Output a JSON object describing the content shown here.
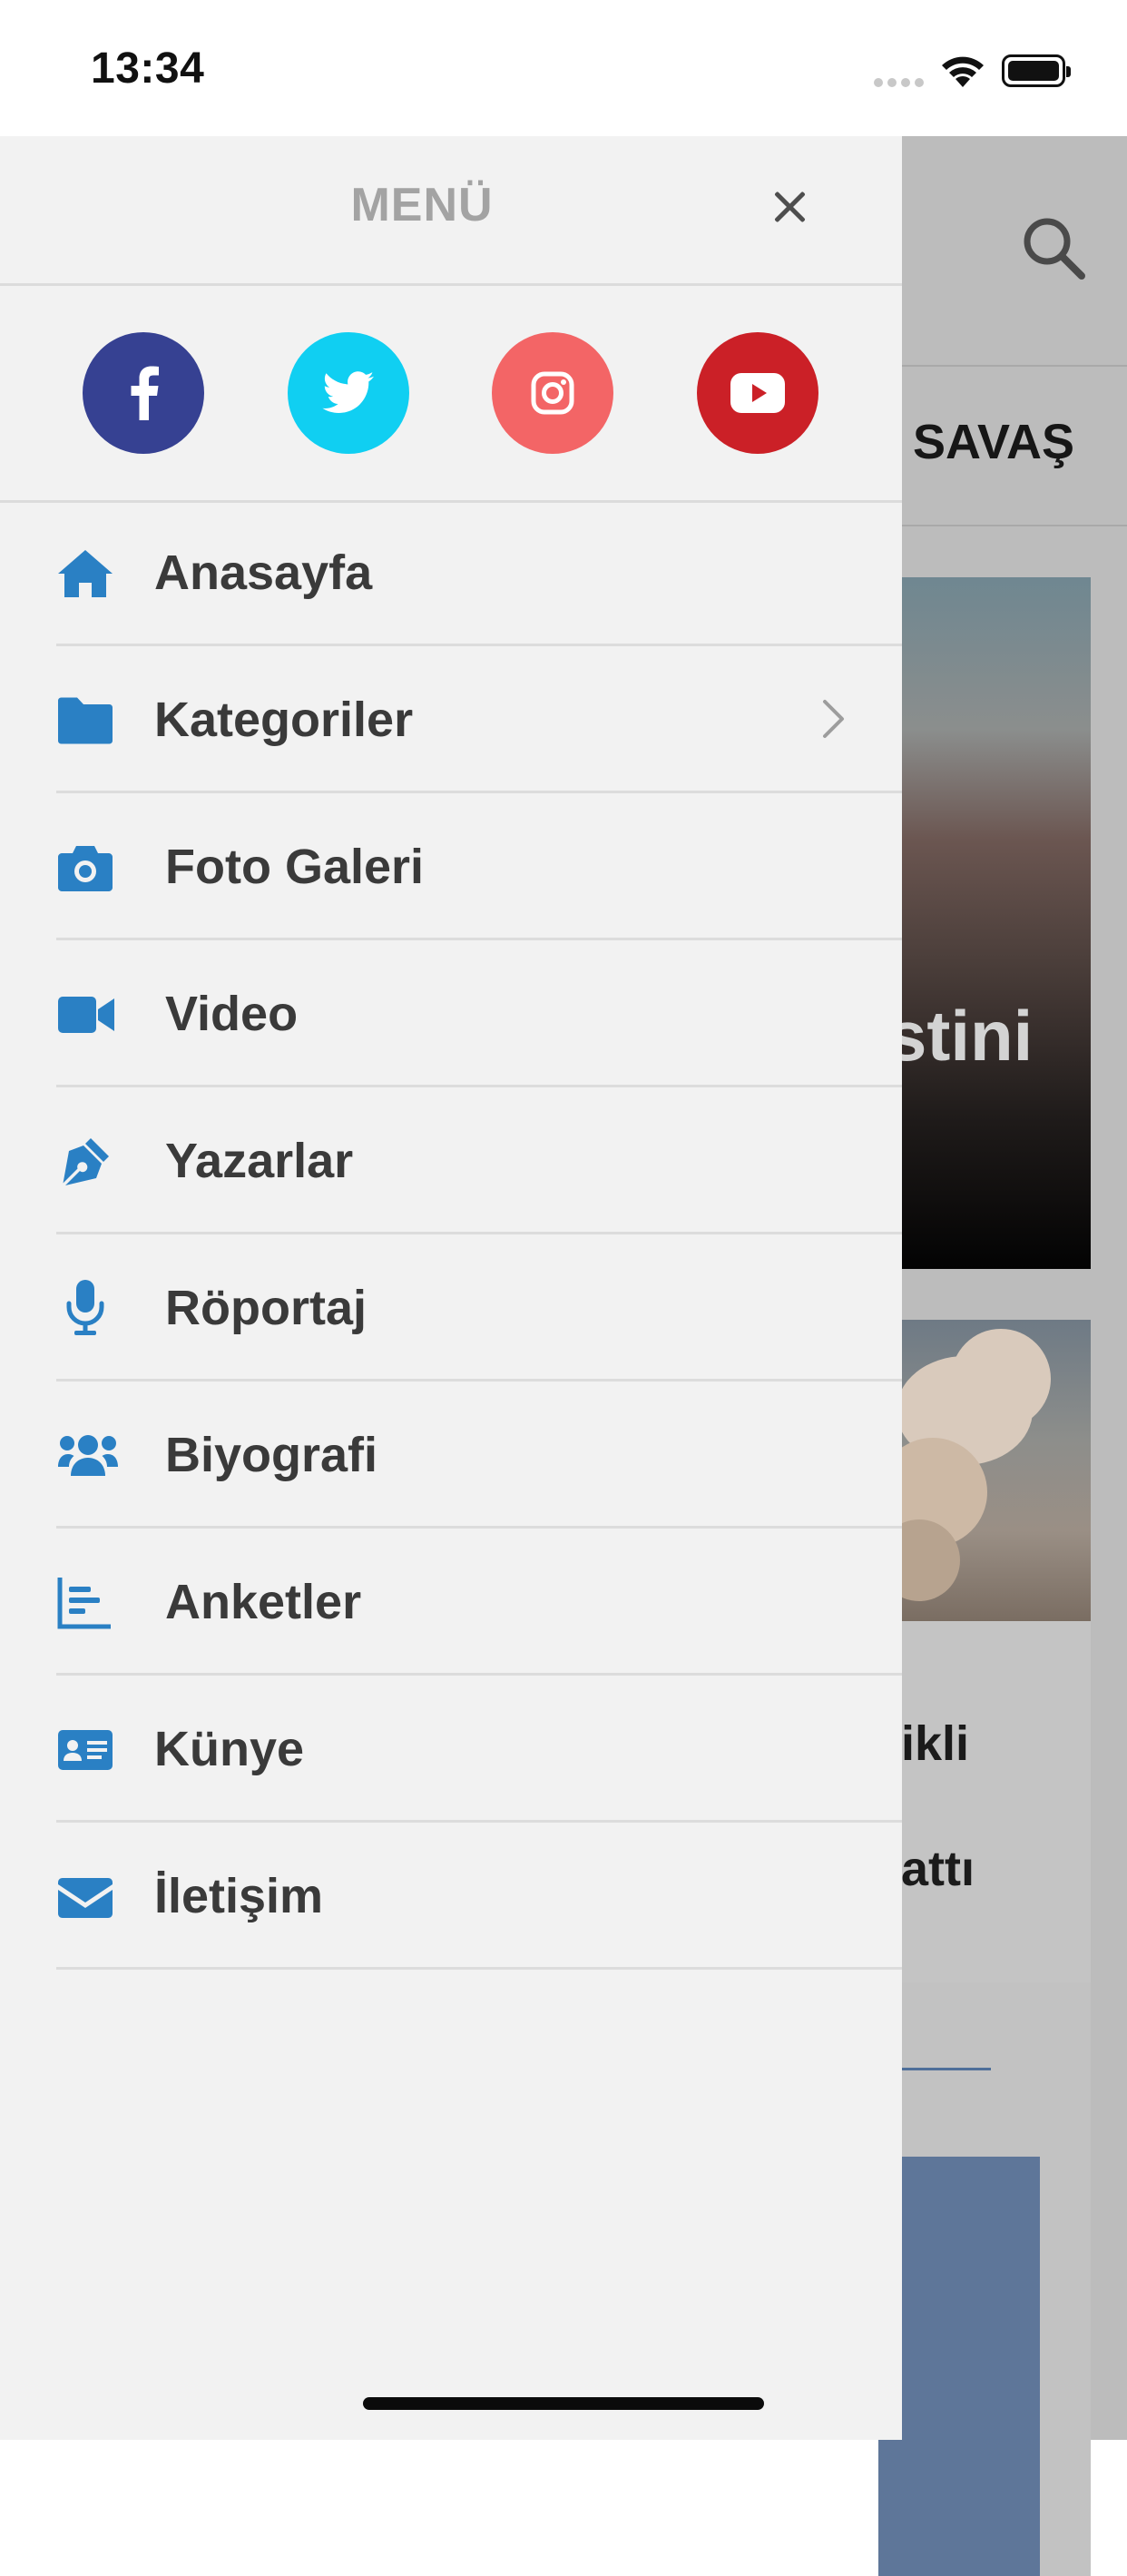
{
  "status_bar": {
    "time": "13:34"
  },
  "background_app": {
    "tab_label": "SAVAŞ",
    "featured_text": "stini",
    "story_line_1": "likli",
    "story_line_2": "lattı"
  },
  "drawer": {
    "title": "MENÜ",
    "social": [
      {
        "name": "facebook",
        "color": "#364192"
      },
      {
        "name": "twitter",
        "color": "#10cff2"
      },
      {
        "name": "instagram",
        "color": "#f36566"
      },
      {
        "name": "youtube",
        "color": "#cb2027"
      }
    ],
    "accent_color": "#2a80c4",
    "items": [
      {
        "label": "Anasayfa",
        "icon": "home-icon"
      },
      {
        "label": "Kategoriler",
        "icon": "folder-icon",
        "has_submenu": true
      },
      {
        "label": "Foto Galeri",
        "icon": "camera-icon"
      },
      {
        "label": "Video",
        "icon": "video-camera-icon"
      },
      {
        "label": "Yazarlar",
        "icon": "pen-nib-icon"
      },
      {
        "label": "Röportaj",
        "icon": "microphone-icon"
      },
      {
        "label": "Biyografi",
        "icon": "users-icon"
      },
      {
        "label": "Anketler",
        "icon": "bar-chart-icon"
      },
      {
        "label": "Künye",
        "icon": "id-card-icon"
      },
      {
        "label": "İletişim",
        "icon": "envelope-icon"
      }
    ]
  }
}
